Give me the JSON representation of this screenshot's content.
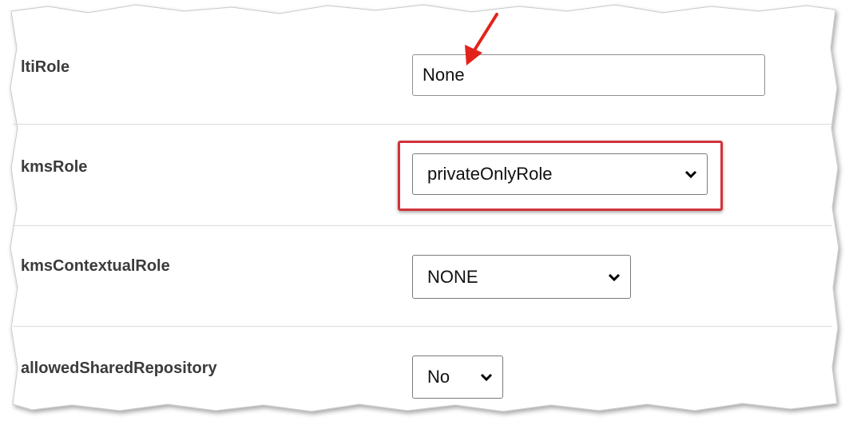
{
  "form": {
    "rows": [
      {
        "label": "ltiRole",
        "value": "None"
      },
      {
        "label": "kmsRole",
        "value": "privateOnlyRole"
      },
      {
        "label": "kmsContextualRole",
        "value": "NONE"
      },
      {
        "label": "allowedSharedRepository",
        "value": "No"
      }
    ]
  },
  "annotations": {
    "highlight_color": "#d1333b",
    "arrow_color": "#e2231a"
  }
}
